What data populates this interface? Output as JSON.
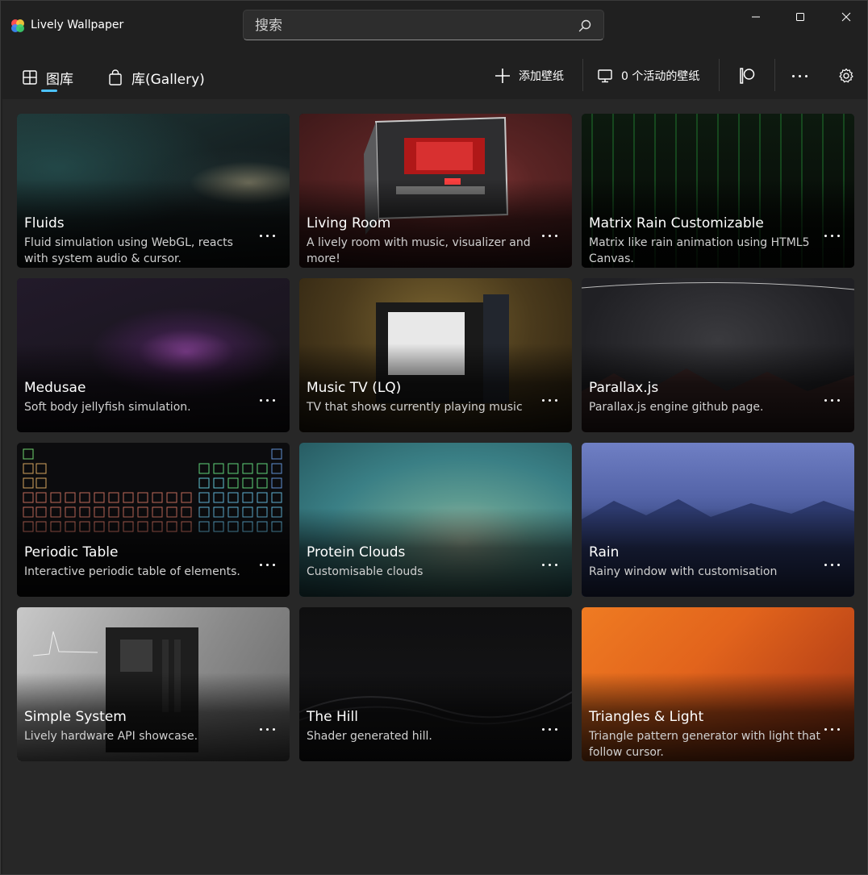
{
  "app": {
    "title": "Lively Wallpaper"
  },
  "search": {
    "placeholder": "搜索"
  },
  "nav": {
    "tabs": [
      {
        "label": "图库",
        "icon": "grid-icon",
        "selected": true
      },
      {
        "label": "库(Gallery)",
        "icon": "bag-icon",
        "selected": false
      }
    ],
    "add_label": "添加壁纸",
    "active_label": "0 个活动的壁纸"
  },
  "colors": {
    "accent": "#4cc2ff",
    "background": "#202020",
    "content": "#272727"
  },
  "wallpapers": [
    {
      "title": "Fluids",
      "description": "Fluid simulation using WebGL, reacts with system audio & cursor."
    },
    {
      "title": "Living Room",
      "description": "A lively room with music, visualizer and more!"
    },
    {
      "title": "Matrix Rain Customizable",
      "description": "Matrix like rain animation using HTML5 Canvas."
    },
    {
      "title": "Medusae",
      "description": "Soft body jellyfish simulation."
    },
    {
      "title": "Music TV (LQ)",
      "description": "TV that shows currently playing music"
    },
    {
      "title": "Parallax.js",
      "description": "Parallax.js engine github page."
    },
    {
      "title": "Periodic Table",
      "description": "Interactive periodic table of elements."
    },
    {
      "title": "Protein Clouds",
      "description": "Customisable clouds"
    },
    {
      "title": "Rain",
      "description": "Rainy window with customisation"
    },
    {
      "title": "Simple System",
      "description": "Lively hardware API showcase."
    },
    {
      "title": "The Hill",
      "description": "Shader generated hill."
    },
    {
      "title": "Triangles & Light",
      "description": "Triangle pattern generator with light that follow cursor."
    }
  ]
}
